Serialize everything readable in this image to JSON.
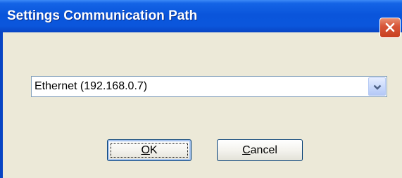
{
  "window": {
    "title": "Settings Communication Path"
  },
  "titlebar_buttons": {
    "close_icon": "close-icon"
  },
  "path_select": {
    "selected": "Ethernet (192.168.0.7)",
    "arrow_icon": "chevron-down-icon"
  },
  "buttons": {
    "ok": {
      "mnemonic": "O",
      "rest": "K"
    },
    "cancel": {
      "mnemonic": "C",
      "rest": "ancel"
    }
  },
  "colors": {
    "titlebar": "#0a55db",
    "client_background": "#ece9d8",
    "close_button": "#d8573a"
  }
}
